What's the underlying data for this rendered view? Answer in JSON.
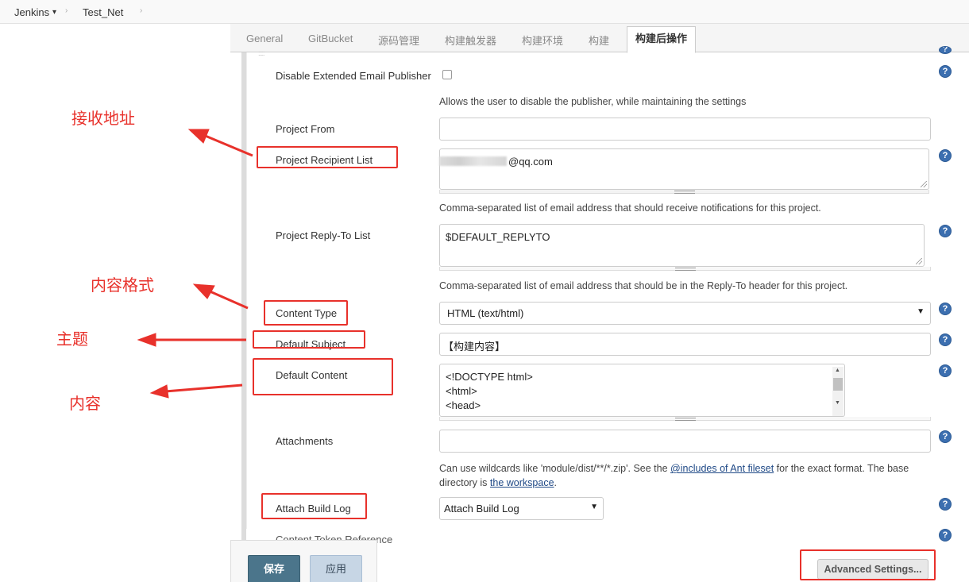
{
  "breadcrumb": {
    "root": "Jenkins",
    "root_caret": "▾",
    "separator": "›",
    "project": "Test_Net"
  },
  "tabs": [
    {
      "label": "General"
    },
    {
      "label": "GitBucket"
    },
    {
      "label": "源码管理"
    },
    {
      "label": "构建触发器"
    },
    {
      "label": "构建环境"
    },
    {
      "label": "构建"
    },
    {
      "label": "构建后操作",
      "active": true
    }
  ],
  "form": {
    "disable_publisher": {
      "label": "Disable Extended Email Publisher",
      "checked": false,
      "description": "Allows the user to disable the publisher, while maintaining the settings"
    },
    "project_from": {
      "label": "Project From",
      "value": ""
    },
    "recipient_list": {
      "label": "Project Recipient List",
      "value": "@qq.com",
      "description": "Comma-separated list of email address that should receive notifications for this project."
    },
    "reply_to": {
      "label": "Project Reply-To List",
      "value": "$DEFAULT_REPLYTO",
      "description": "Comma-separated list of email address that should be in the Reply-To header for this project."
    },
    "content_type": {
      "label": "Content Type",
      "value": "HTML (text/html)"
    },
    "default_subject": {
      "label": "Default Subject",
      "value": "【构建内容】"
    },
    "default_content": {
      "label": "Default Content",
      "lines": [
        "<!DOCTYPE html>",
        "<html>",
        "<head>"
      ]
    },
    "attachments": {
      "label": "Attachments",
      "value": "",
      "desc_prefix": "Can use wildcards like 'module/dist/**/*.zip'. See the",
      "desc_link1": "@includes of Ant fileset",
      "desc_middle": "for the exact format. The base",
      "desc_line2_prefix": "directory is",
      "desc_link2": "the workspace",
      "desc_suffix": "."
    },
    "attach_build_log": {
      "label": "Attach Build Log",
      "value": "Attach Build Log"
    },
    "content_token": {
      "label": "Content Token Reference"
    },
    "help_glyph": "?"
  },
  "buttons": {
    "save": "保存",
    "apply": "应用",
    "advanced": "Advanced Settings..."
  },
  "annotations": {
    "recipient": "接收地址",
    "content_type": "内容格式",
    "subject": "主题",
    "content": "内容"
  },
  "colors": {
    "annotation_red": "#e8312b",
    "save_button": "#4b758b",
    "apply_button": "#c7d6e5",
    "help_icon": "#3c6fb0"
  }
}
